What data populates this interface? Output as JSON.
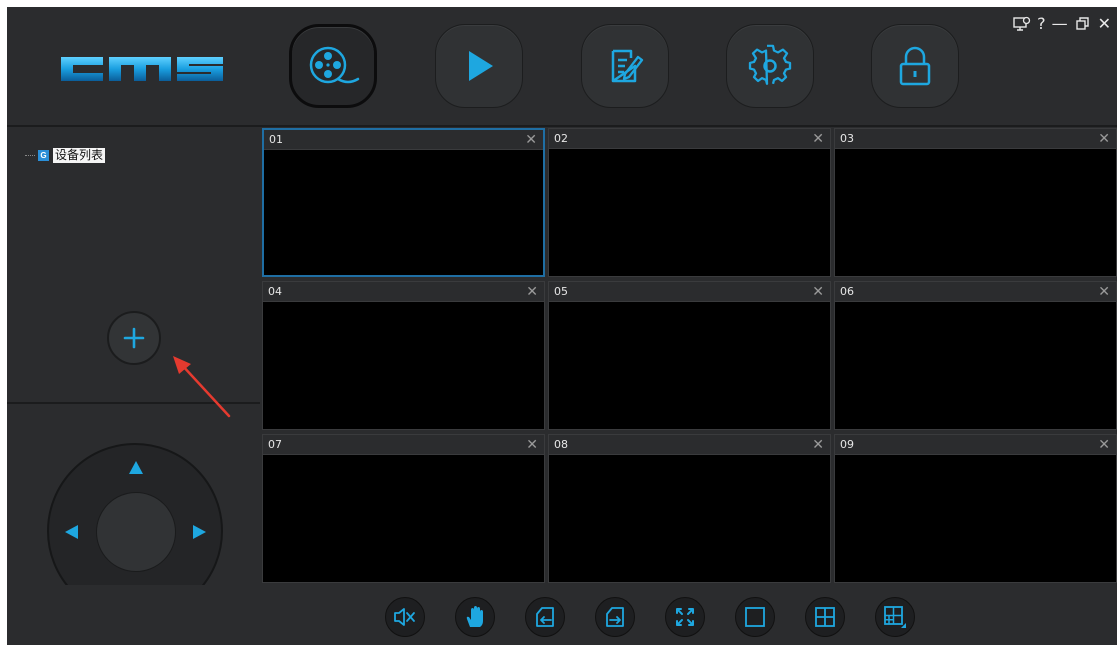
{
  "app": {
    "logo_text": "cms",
    "colors": {
      "accent": "#1ea7e0",
      "background": "#2b2c2e",
      "video_bg": "#000000",
      "active_cell_border": "#1f6ea3",
      "annotation": "#e53a2f"
    }
  },
  "nav": [
    {
      "name": "live-view",
      "icon": "film-reel-icon",
      "active": true
    },
    {
      "name": "playback",
      "icon": "play-icon",
      "active": false
    },
    {
      "name": "log",
      "icon": "edit-document-icon",
      "active": false
    },
    {
      "name": "settings",
      "icon": "gear-icon",
      "active": false
    },
    {
      "name": "lock",
      "icon": "padlock-icon",
      "active": false
    }
  ],
  "window_controls": {
    "help": "?",
    "minimize": "—",
    "close": "✕"
  },
  "device_tree": {
    "root_label": "设备列表",
    "root_icon_letter": "G"
  },
  "video_cells": [
    {
      "label": "01",
      "close": "✕",
      "active": true
    },
    {
      "label": "02",
      "close": "✕",
      "active": false
    },
    {
      "label": "03",
      "close": "✕",
      "active": false
    },
    {
      "label": "04",
      "close": "✕",
      "active": false
    },
    {
      "label": "05",
      "close": "✕",
      "active": false
    },
    {
      "label": "06",
      "close": "✕",
      "active": false
    },
    {
      "label": "07",
      "close": "✕",
      "active": false
    },
    {
      "label": "08",
      "close": "✕",
      "active": false
    },
    {
      "label": "09",
      "close": "✕",
      "active": false
    }
  ],
  "bottom_toolbar": [
    {
      "name": "mute",
      "icon": "speaker-mute-icon"
    },
    {
      "name": "hand",
      "icon": "hand-icon"
    },
    {
      "name": "previous-page",
      "icon": "page-prev-icon"
    },
    {
      "name": "next-page",
      "icon": "page-next-icon"
    },
    {
      "name": "fullscreen",
      "icon": "fullscreen-icon"
    },
    {
      "name": "layout-1",
      "icon": "single-screen-icon"
    },
    {
      "name": "layout-4",
      "icon": "quad-screen-icon"
    },
    {
      "name": "layout-more",
      "icon": "multi-screen-icon"
    }
  ]
}
